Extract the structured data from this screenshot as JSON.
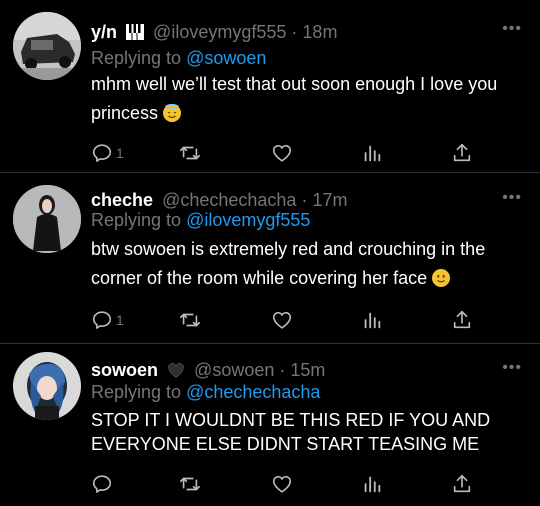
{
  "tweets": [
    {
      "name": "y/n",
      "name_icon": "piano-keys-icon",
      "handle": "@iloveymygf555",
      "time": "18m",
      "reply_prefix": "Replying to",
      "reply_to": "@sowoen",
      "body": "mhm well we’ll test that out soon enough I love you princess",
      "emoji": "smiling-face-with-halo",
      "reply_count": "1",
      "avatar": "gray-car-avatar"
    },
    {
      "name": "cheche",
      "handle": "@chechechacha",
      "time": "17m",
      "reply_prefix": "Replying to",
      "reply_to": "@ilovemygf555",
      "body": "btw sowoen is extremely red and crouching in the corner of the room while covering her face",
      "emoji": "slightly-smiling-face",
      "reply_count": "1",
      "avatar": "girl-in-black-dress-avatar"
    },
    {
      "name": "sowoen",
      "name_icon": "black-heart-icon",
      "handle": "@sowoen",
      "time": "15m",
      "reply_prefix": "Replying to",
      "reply_to": "@chechechacha",
      "body": "STOP IT I WOULDNT BE THIS RED IF YOU AND EVERYONE ELSE DIDNT START TEASING ME",
      "reply_count": "",
      "avatar": "blue-hair-girl-avatar"
    }
  ],
  "separator_dot": "·",
  "more_glyph": "•••",
  "colors": {
    "background": "#000000",
    "text": "#ffffff",
    "muted": "#71767b",
    "link": "#1d9bf0",
    "divider": "#2f3336"
  }
}
